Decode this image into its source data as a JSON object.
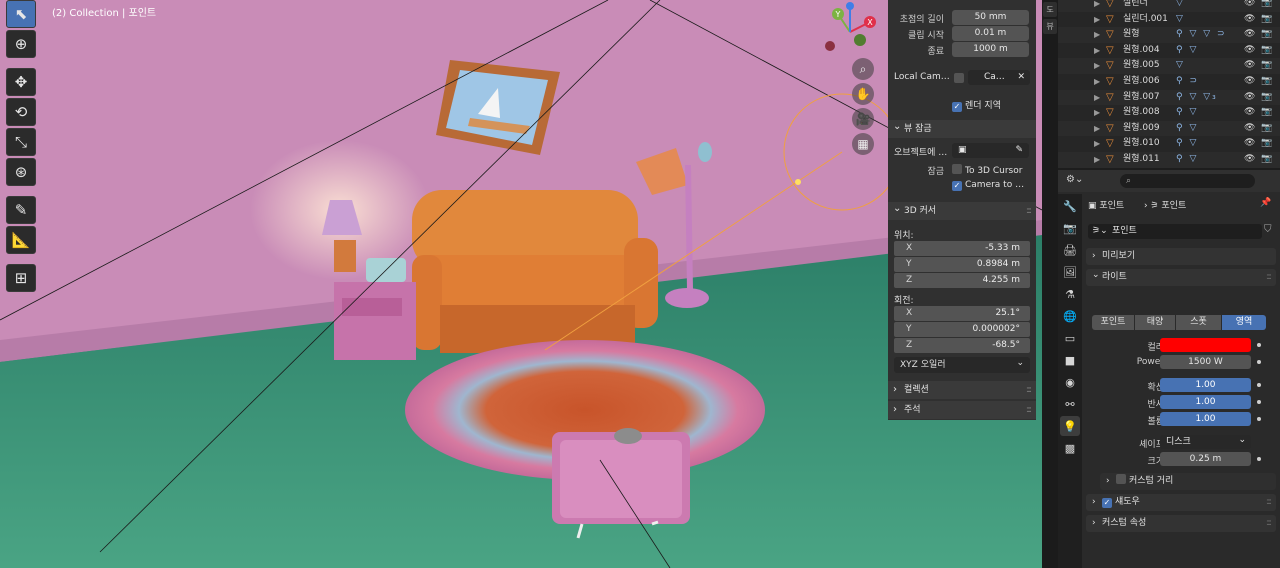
{
  "viewport": {
    "label": "(2) Collection | 포인트",
    "gizmo": {
      "x": "X",
      "y": "Y",
      "z": "Z",
      "x_color": "#e0304a",
      "y_color": "#7cb342",
      "z_color": "#3f7ee8"
    },
    "tools": [
      "select-box-icon",
      "cursor-icon",
      "move-icon",
      "rotate-icon",
      "scale-icon",
      "transform-icon",
      "annotate-icon",
      "measure-icon",
      "add-cube-icon"
    ],
    "nav_buttons": [
      "zoom-icon",
      "hand-icon",
      "camera-icon",
      "grid-icon"
    ]
  },
  "npanel": {
    "focal_length_label": "초점의 길이",
    "focal_length_value": "50 mm",
    "clip_start_label": "클립 시작",
    "clip_start_value": "0.01 m",
    "clip_end_label": "종료",
    "clip_end_value": "1000 m",
    "local_camera_label": "Local Cam…",
    "local_camera_value": "Ca…",
    "render_region_label": "렌더 지역",
    "view_lock_header": "뷰 잠금",
    "lock_object_label": "오브젝트에 …",
    "lock_label": "잠금",
    "lock_to_cursor": "To 3D Cursor",
    "camera_to": "Camera to …",
    "cursor_header": "3D 커서",
    "location_label": "위치:",
    "loc": [
      {
        "axis": "X",
        "value": "-5.33 m"
      },
      {
        "axis": "Y",
        "value": "0.8984 m"
      },
      {
        "axis": "Z",
        "value": "4.255 m"
      }
    ],
    "rotation_label": "회전:",
    "rot": [
      {
        "axis": "X",
        "value": "25.1°"
      },
      {
        "axis": "Y",
        "value": "0.000002°"
      },
      {
        "axis": "Z",
        "value": "-68.5°"
      }
    ],
    "rotation_mode": "XYZ 오일러",
    "collection_header": "컬렉션",
    "annotation_header": "주석"
  },
  "midstrip": {
    "tabs": [
      "도",
      "뷰"
    ]
  },
  "outliner": {
    "rows": [
      {
        "name": "실린더",
        "mods": "▽"
      },
      {
        "name": "실린더.001",
        "mods": "▽"
      },
      {
        "name": "원형",
        "mods": "⚲ ▽ ▽ ⊃"
      },
      {
        "name": "원형.004",
        "mods": "⚲ ▽"
      },
      {
        "name": "원형.005",
        "mods": "▽"
      },
      {
        "name": "원형.006",
        "mods": "⚲ ⊃"
      },
      {
        "name": "원형.007",
        "mods": "⚲ ▽ ▽₃"
      },
      {
        "name": "원형.008",
        "mods": "⚲ ▽"
      },
      {
        "name": "원형.009",
        "mods": "⚲ ▽"
      },
      {
        "name": "원형.010",
        "mods": "⚲ ▽"
      },
      {
        "name": "원형.011",
        "mods": "⚲ ▽"
      }
    ]
  },
  "properties": {
    "crumb_object": "포인트",
    "crumb_data": "포인트",
    "data_name": "포인트",
    "preview_header": "미리보기",
    "light_header": "라이트",
    "light_types": [
      {
        "label": "포인트",
        "active": false
      },
      {
        "label": "태양",
        "active": false
      },
      {
        "label": "스폿",
        "active": false
      },
      {
        "label": "영역",
        "active": true
      }
    ],
    "color_label": "컬러",
    "color_value": "#ff0000",
    "power_label": "Power",
    "power_value": "1500 W",
    "diffuse_label": "확산",
    "diffuse_value": "1.00",
    "specular_label": "반사",
    "specular_value": "1.00",
    "volume_label": "볼륨",
    "volume_value": "1.00",
    "shape_label": "셰이프",
    "shape_value": "디스크",
    "size_label": "크기",
    "size_value": "0.25 m",
    "custom_distance_label": "커스텀 거리",
    "shadow_header": "섀도우",
    "custom_props_header": "커스텀 속성"
  }
}
